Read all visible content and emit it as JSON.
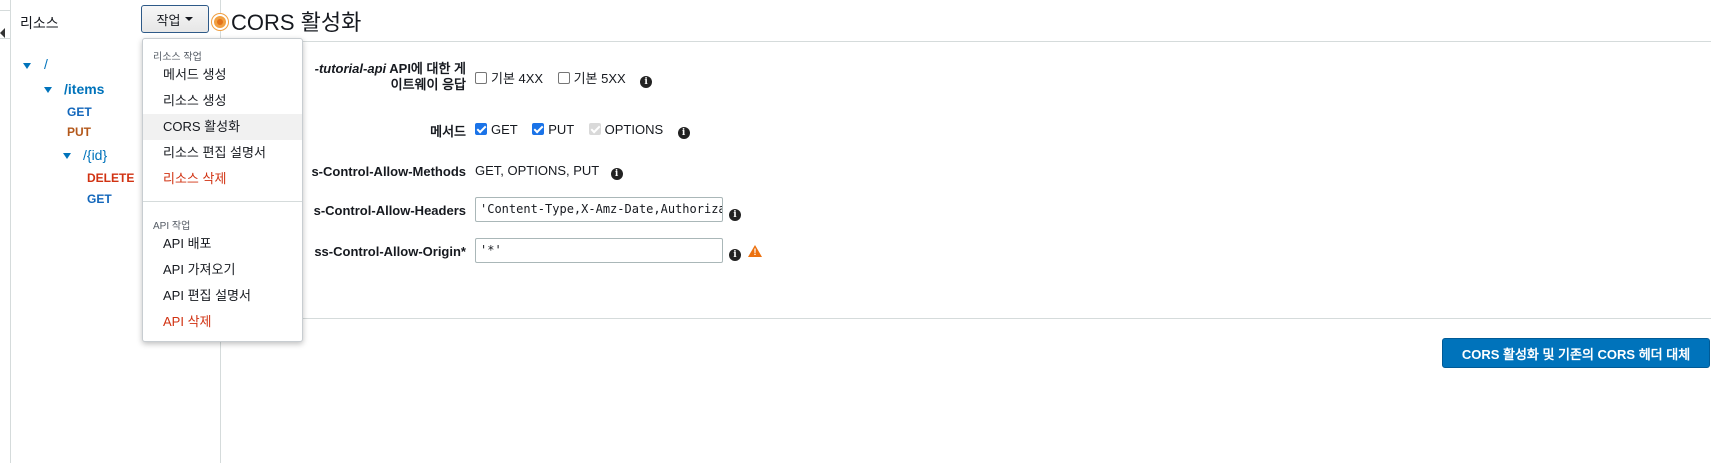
{
  "sidebar": {
    "title": "리소스",
    "action_button": "작업",
    "tree": {
      "root": "/",
      "items_label": "/items",
      "items_methods": [
        "GET",
        "PUT"
      ],
      "id_label": "/{id}",
      "id_methods": [
        "DELETE",
        "GET"
      ]
    }
  },
  "menu": {
    "resource_section": "리소스 작업",
    "resource_items": [
      "메서드 생성",
      "리소스 생성",
      "CORS 활성화",
      "리소스 편집 설명서",
      "리소스 삭제"
    ],
    "api_section": "API 작업",
    "api_items": [
      "API 배포",
      "API 가져오기",
      "API 편집 설명서",
      "API 삭제"
    ]
  },
  "main": {
    "title": "CORS 활성화",
    "gateway_label_italic": "-tutorial-api",
    "gateway_label_rest": " API에 대한 게",
    "gateway_label_line2": "이트웨이 응답",
    "gateway_options": [
      "기본 4XX",
      "기본 5XX"
    ],
    "methods_label": "메서드",
    "methods": [
      "GET",
      "PUT",
      "OPTIONS"
    ],
    "allow_methods_label": "s-Control-Allow-Methods",
    "allow_methods_value": "GET, OPTIONS, PUT",
    "allow_headers_label": "s-Control-Allow-Headers",
    "allow_headers_value": "'Content-Type,X-Amz-Date,Authorization,",
    "allow_origin_label": "ss-Control-Allow-Origin*",
    "allow_origin_value": "'*'",
    "submit_button": "CORS 활성화 및 기존의 CORS 헤더 대체"
  },
  "colors": {
    "accent": "#0073bb",
    "danger": "#d13212",
    "put": "#b3581b",
    "warning": "#ec7211"
  }
}
